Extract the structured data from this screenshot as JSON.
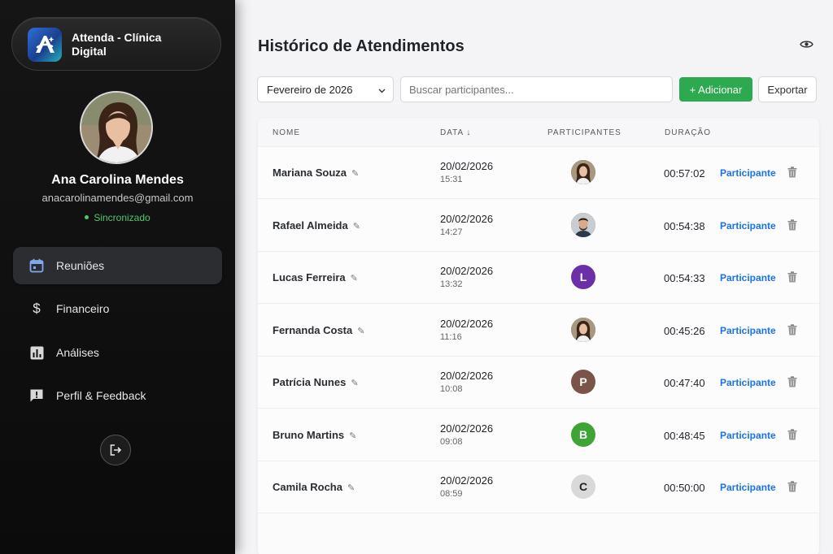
{
  "app": {
    "brand_line1": "Attenda - Clínica",
    "brand_line2": "Digital",
    "accent": "#2daa4f",
    "link_color": "#1a73e8"
  },
  "user": {
    "name": "Ana Carolina Mendes",
    "email": "anacarolinamendes@gmail.com",
    "status": "Sincronizado",
    "status_color": "#4cc96b"
  },
  "sidebar": {
    "items": [
      {
        "label": "Reuniões",
        "icon": "calendar-icon",
        "active": true
      },
      {
        "label": "Financeiro",
        "icon": "dollar-icon",
        "active": false
      },
      {
        "label": "Análises",
        "icon": "bar-chart-icon",
        "active": false
      },
      {
        "label": "Perfil & Feedback",
        "icon": "feedback-icon",
        "active": false
      }
    ],
    "logout_icon": "logout-icon"
  },
  "main": {
    "title": "Histórico de Atendimentos",
    "month_select": "Fevereiro de 2026",
    "search_placeholder": "Buscar participantes...",
    "add_button": "+ Adicionar",
    "export_button": "Exportar"
  },
  "table": {
    "headers": {
      "name": "NOME",
      "date": "DATA ↓",
      "participants": "PARTICIPANTES",
      "duration": "DURAÇÃO"
    },
    "rows": [
      {
        "name": "Mariana Souza",
        "date": "20/02/2026",
        "time": "15:31",
        "avatar": "photo-woman",
        "initial": "",
        "avatar_color": "#7a5a45",
        "duration": "00:57:02",
        "link": "Participante"
      },
      {
        "name": "Rafael Almeida",
        "date": "20/02/2026",
        "time": "14:27",
        "avatar": "photo-man",
        "initial": "",
        "avatar_color": "#5a6a78",
        "duration": "00:54:38",
        "link": "Participante"
      },
      {
        "name": "Lucas Ferreira",
        "date": "20/02/2026",
        "time": "13:32",
        "avatar": "initial",
        "initial": "L",
        "avatar_color": "#6b2fa8",
        "duration": "00:54:33",
        "link": "Participante"
      },
      {
        "name": "Fernanda Costa",
        "date": "20/02/2026",
        "time": "11:16",
        "avatar": "photo-woman",
        "initial": "",
        "avatar_color": "#7a5a45",
        "duration": "00:45:26",
        "link": "Participante"
      },
      {
        "name": "Patrícia Nunes",
        "date": "20/02/2026",
        "time": "10:08",
        "avatar": "initial",
        "initial": "P",
        "avatar_color": "#7a5448",
        "duration": "00:47:40",
        "link": "Participante"
      },
      {
        "name": "Bruno Martins",
        "date": "20/02/2026",
        "time": "09:08",
        "avatar": "initial",
        "initial": "B",
        "avatar_color": "#3ea436",
        "duration": "00:48:45",
        "link": "Participante"
      },
      {
        "name": "Camila Rocha",
        "date": "20/02/2026",
        "time": "08:59",
        "avatar": "initial",
        "initial": "C",
        "avatar_color": "#d9d9d9",
        "duration": "00:50:00",
        "link": "Participante"
      }
    ]
  }
}
